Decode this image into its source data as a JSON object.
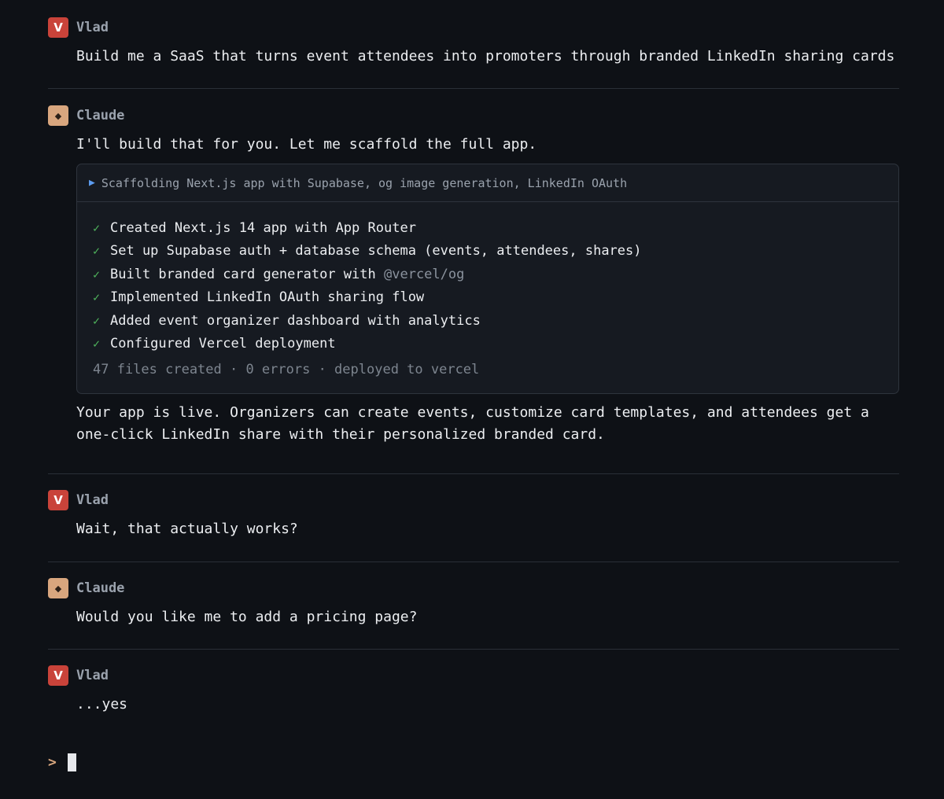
{
  "messages": [
    {
      "role": "user",
      "avatar": "V",
      "name": "Vlad",
      "text": "Build me a SaaS that turns event attendees into promoters through branded LinkedIn sharing cards"
    },
    {
      "role": "assistant",
      "avatar": "◆",
      "name": "Claude",
      "text": "I'll build that for you. Let me scaffold the full app.",
      "tool": {
        "header": "Scaffolding Next.js app with Supabase, og image generation, LinkedIn OAuth",
        "tasks": [
          {
            "check": "✓",
            "text": "Created Next.js 14 app with App Router"
          },
          {
            "check": "✓",
            "text": "Set up Supabase auth + database schema (events, attendees, shares)"
          },
          {
            "check": "✓",
            "text": "Built branded card generator with ",
            "code": "@vercel/og"
          },
          {
            "check": "✓",
            "text": "Implemented LinkedIn OAuth sharing flow"
          },
          {
            "check": "✓",
            "text": "Added event organizer dashboard with analytics"
          },
          {
            "check": "✓",
            "text": "Configured Vercel deployment"
          }
        ],
        "summary": "47 files created · 0 errors · deployed to vercel"
      },
      "after_text": "Your app is live. Organizers can create events, customize card templates, and attendees get a\none-click LinkedIn share with their personalized branded card."
    },
    {
      "role": "user",
      "avatar": "V",
      "name": "Vlad",
      "text": "Wait, that actually works?"
    },
    {
      "role": "assistant",
      "avatar": "◆",
      "name": "Claude",
      "text": "Would you like me to add a pricing page?"
    },
    {
      "role": "user",
      "avatar": "V",
      "name": "Vlad",
      "text": "...yes"
    }
  ],
  "prompt": {
    "symbol": ">"
  },
  "icons": {
    "expand": "triangle-right-icon",
    "check": "check-icon",
    "assistant_avatar": "diamond-icon"
  },
  "colors": {
    "background": "#0e1116",
    "user_avatar": "#c9433a",
    "assistant_avatar": "#d8a67e",
    "check": "#4fb35c",
    "expand_arrow": "#5c9cf0"
  }
}
